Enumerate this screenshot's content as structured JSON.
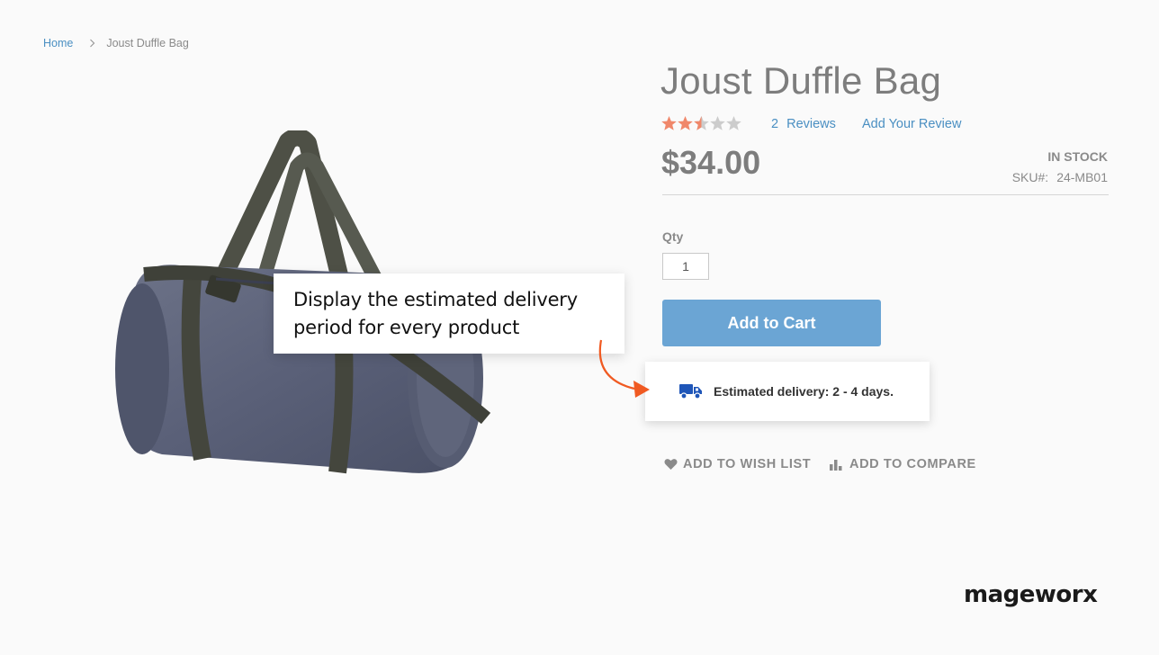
{
  "breadcrumb": {
    "home": "Home",
    "separator_icon": "chevron-right-icon",
    "current": "Joust Duffle Bag"
  },
  "product": {
    "title": "Joust Duffle Bag",
    "rating_stars": 2.5,
    "rating_max": 5,
    "reviews_count": "2",
    "reviews_label": "Reviews",
    "add_review": "Add Your Review",
    "price": "$34.00",
    "stock": "IN STOCK",
    "sku_label": "SKU#:",
    "sku_value": "24-MB01",
    "image_icon": "duffle-bag-image"
  },
  "cart": {
    "qty_label": "Qty",
    "qty_value": "1",
    "add_to_cart": "Add to Cart"
  },
  "delivery": {
    "icon": "truck-icon",
    "text": "Estimated delivery: 2 - 4 days."
  },
  "actions": {
    "wishlist": "ADD TO WISH LIST",
    "compare": "ADD TO COMPARE"
  },
  "callout": {
    "text": "Display the estimated delivery period for every product"
  },
  "brand": {
    "name": "mageworx"
  },
  "colors": {
    "link": "#4a8fc2",
    "button": "#6ba5d4",
    "star_filled": "#f0876a",
    "star_empty": "#cccccc",
    "arrow": "#f05a22",
    "truck": "#1f56b8"
  }
}
